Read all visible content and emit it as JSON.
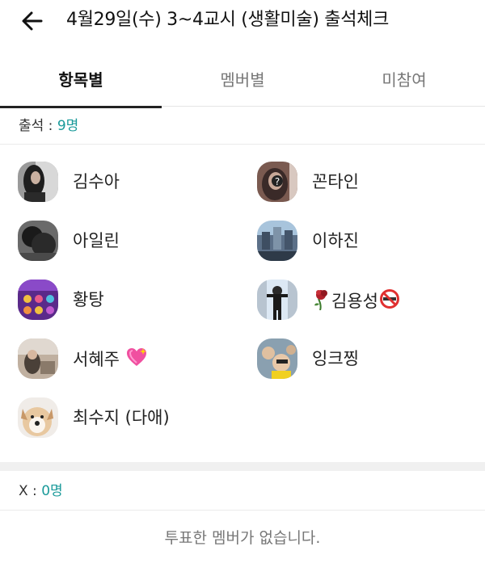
{
  "header": {
    "back_icon": "arrow-left-icon",
    "title": "4월29일(수) 3~4교시 (생활미술) 출석체크"
  },
  "tabs": [
    {
      "label": "항목별",
      "active": true
    },
    {
      "label": "멤버별",
      "active": false
    },
    {
      "label": "미참여",
      "active": false
    }
  ],
  "attendance": {
    "label": "출석",
    "separator": " : ",
    "count": "9명",
    "members": [
      {
        "name": "김수아"
      },
      {
        "name": "꼰타인"
      },
      {
        "name": "아일린"
      },
      {
        "name": "이하진"
      },
      {
        "name": "황탕"
      },
      {
        "name": "김용성",
        "prefix_emoji": "wilted-rose-icon",
        "suffix_emoji": "no-smoking-icon"
      },
      {
        "name": "서혜주",
        "suffix_emoji": "sparkling-heart-icon"
      },
      {
        "name": "잉크찡"
      },
      {
        "name": "최수지 (다애)"
      }
    ]
  },
  "absent": {
    "label": "X",
    "separator": " : ",
    "count": "0명",
    "empty_message": "투표한 멤버가 없습니다."
  },
  "colors": {
    "accent": "#1a9a9a",
    "band": "#f0f0f0"
  }
}
